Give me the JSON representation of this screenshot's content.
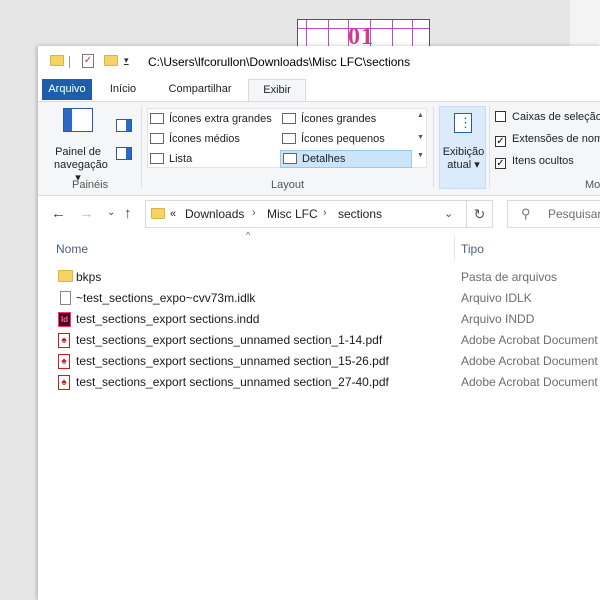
{
  "background": {
    "page_number": "01"
  },
  "titlebar": {
    "path": "C:\\Users\\lfcorullon\\Downloads\\Misc LFC\\sections",
    "icons": [
      "folder-icon",
      "properties-icon",
      "new-folder-icon",
      "customize-dropdown-icon"
    ]
  },
  "tabs": [
    {
      "label": "Arquivo"
    },
    {
      "label": "Início"
    },
    {
      "label": "Compartilhar"
    },
    {
      "label": "Exibir",
      "active": true
    }
  ],
  "ribbon": {
    "panes_group": {
      "label": "Painéis",
      "nav_pane_line1": "Painel de",
      "nav_pane_line2": "navegação ▾"
    },
    "layout_group": {
      "label": "Layout",
      "items": [
        {
          "label": "Ícones extra grandes"
        },
        {
          "label": "Ícones grandes"
        },
        {
          "label": "Ícones médios"
        },
        {
          "label": "Ícones pequenos"
        },
        {
          "label": "Lista"
        },
        {
          "label": "Detalhes",
          "selected": true
        }
      ]
    },
    "current_view": {
      "line1": "Exibição",
      "line2": "atual ▾"
    },
    "show_hide": {
      "group_label_partial": "Mo",
      "checkboxes": [
        {
          "label": "Caixas de seleção",
          "checked": false
        },
        {
          "label": "Extensões de nomes",
          "checked": true
        },
        {
          "label": "Itens ocultos",
          "checked": true
        }
      ]
    }
  },
  "address": {
    "overflow": "«",
    "crumbs": [
      "Downloads",
      "Misc LFC",
      "sections"
    ],
    "search_placeholder": "Pesquisar"
  },
  "columns": {
    "name": "Nome",
    "type": "Tipo"
  },
  "files": [
    {
      "name": "bkps",
      "type": "Pasta de arquivos",
      "icon": "folder-icon"
    },
    {
      "name": "~test_sections_expo~cvv73m.idlk",
      "type": "Arquivo IDLK",
      "icon": "file-icon"
    },
    {
      "name": "test_sections_export sections.indd",
      "type": "Arquivo INDD",
      "icon": "indesign-icon"
    },
    {
      "name": "test_sections_export sections_unnamed section_1-14.pdf",
      "type": "Adobe Acrobat Document",
      "icon": "pdf-icon"
    },
    {
      "name": "test_sections_export sections_unnamed section_15-26.pdf",
      "type": "Adobe Acrobat Document",
      "icon": "pdf-icon"
    },
    {
      "name": "test_sections_export sections_unnamed section_27-40.pdf",
      "type": "Adobe Acrobat Document",
      "icon": "pdf-icon"
    }
  ],
  "colors": {
    "file_tab": "#1e5ea8",
    "selection": "#cce4f7",
    "folder": "#f6d365",
    "pdf_red": "#c01f1f"
  }
}
